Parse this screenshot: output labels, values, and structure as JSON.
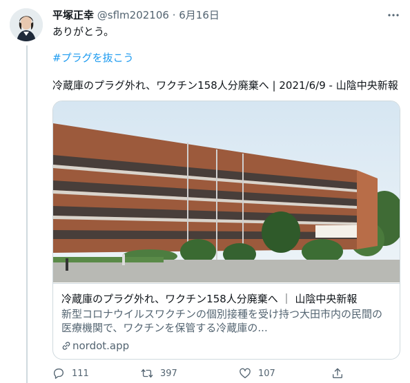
{
  "tweet": {
    "display_name": "平塚正幸",
    "handle": "@sflm202106",
    "separator": " · ",
    "date": "6月16日",
    "text_line1": "ありがとう。",
    "hashtag": "#プラグを抜こう",
    "headline": "冷蔵庫のプラグ外れ、ワクチン158人分廃棄へ | 2021/6/9 - 山陰中央新報"
  },
  "card": {
    "title": "冷蔵庫のプラグ外れ、ワクチン158人分廃棄へ ｜ 山陰中央新報",
    "description": "新型コロナウイルスワクチンの個別接種を受け持つ大田市内の民間の医療機関で、ワクチンを保管する冷蔵庫の...",
    "domain": "nordot.app"
  },
  "actions": {
    "reply_count": "111",
    "retweet_count": "397",
    "like_count": "107"
  },
  "icons": {
    "more": "more-icon",
    "reply": "reply-icon",
    "retweet": "retweet-icon",
    "like": "heart-icon",
    "share": "share-icon",
    "link": "link-icon"
  },
  "colors": {
    "accent": "#1d9bf0",
    "secondary_text": "#536471",
    "border": "#cfd9de"
  }
}
